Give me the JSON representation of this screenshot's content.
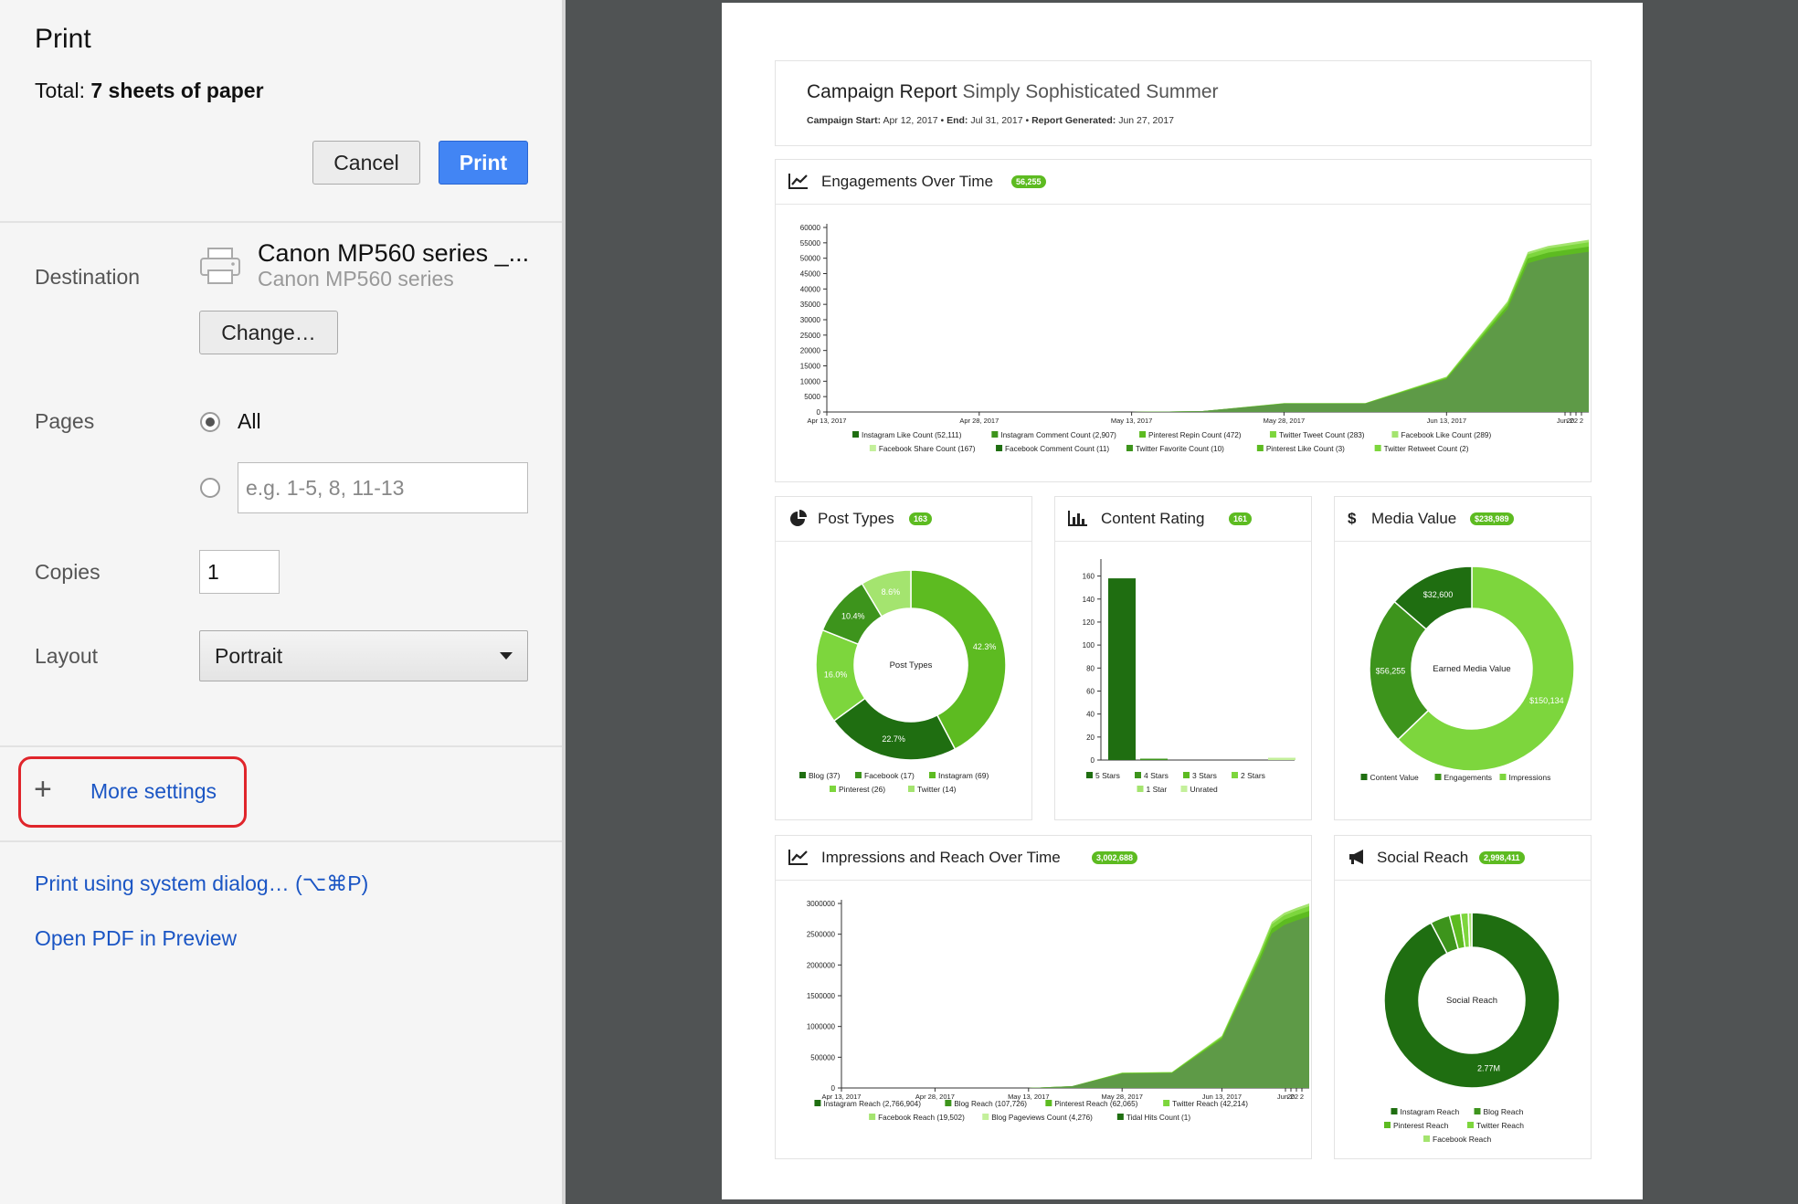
{
  "dialog": {
    "title": "Print",
    "total_label": "Total: ",
    "total_value": "7 sheets of paper",
    "cancel_label": "Cancel",
    "print_label": "Print",
    "destination_label": "Destination",
    "destination_name": "Canon MP560 series _...",
    "destination_sub": "Canon MP560 series",
    "change_label": "Change…",
    "pages_label": "Pages",
    "pages_all_label": "All",
    "pages_placeholder": "e.g. 1-5, 8, 11-13",
    "copies_label": "Copies",
    "copies_value": "1",
    "layout_label": "Layout",
    "layout_value": "Portrait",
    "more_settings_label": "More settings",
    "system_dialog_label": "Print using system dialog… (⌥⌘P)",
    "open_pdf_label": "Open PDF in Preview",
    "highlight_color": "#e0252b",
    "link_color": "#1a55c4",
    "primary_color": "#4285f4"
  },
  "report": {
    "title": "Campaign Report",
    "subtitle": "Simply Sophisticated Summer",
    "start_label": "Campaign Start:",
    "start_value": "Apr 12, 2017",
    "end_label": "End:",
    "end_value": "Jul 31, 2017",
    "generated_label": "Report Generated:",
    "generated_value": "Jun 27, 2017",
    "accent": "#5dbb21",
    "palette": [
      "#1f6e11",
      "#3d941c",
      "#5dbb21",
      "#7dd63d",
      "#a4e46f",
      "#c4f09b"
    ]
  },
  "chart_data": [
    {
      "id": "engagements",
      "type": "area",
      "title": "Engagements Over Time",
      "badge": "56,255",
      "xticks": [
        "Apr 13, 2017",
        "Apr 28, 2017",
        "May 13, 2017",
        "May 28, 2017",
        "Jun 13, 2017",
        "Jun 2",
        "20",
        "2",
        "2"
      ],
      "ylim": [
        0,
        60000
      ],
      "yticks": [
        0,
        5000,
        10000,
        15000,
        20000,
        25000,
        30000,
        35000,
        40000,
        45000,
        50000,
        55000,
        60000
      ],
      "x": [
        "Apr 13, 2017",
        "May 13, 2017",
        "May 20, 2017",
        "May 28, 2017",
        "Jun 5, 2017",
        "Jun 13, 2017",
        "Jun 19, 2017",
        "Jun 21, 2017",
        "Jun 23, 2017",
        "Jun 25, 2017",
        "Jun 27, 2017"
      ],
      "total": [
        0,
        0,
        300,
        2900,
        2900,
        11500,
        36000,
        52000,
        54000,
        55000,
        56000
      ],
      "series": [
        {
          "name": "Instagram Like Count (52,111)"
        },
        {
          "name": "Instagram Comment Count (2,907)"
        },
        {
          "name": "Pinterest Repin Count (472)"
        },
        {
          "name": "Twitter Tweet Count (283)"
        },
        {
          "name": "Facebook Like Count (289)"
        },
        {
          "name": "Facebook Share Count (167)"
        },
        {
          "name": "Facebook Comment Count (11)"
        },
        {
          "name": "Twitter Favorite Count (10)"
        },
        {
          "name": "Pinterest Like Count (3)"
        },
        {
          "name": "Twitter Retweet Count (2)"
        }
      ],
      "legend_rows": [
        5,
        5
      ]
    },
    {
      "id": "post_types",
      "type": "pie",
      "title": "Post Types",
      "badge": "163",
      "center_label": "Post Types",
      "slices": [
        {
          "name": "Instagram (69)",
          "value": 42.3,
          "label": "42.3%"
        },
        {
          "name": "Blog (37)",
          "value": 22.7,
          "label": "22.7%"
        },
        {
          "name": "Pinterest (26)",
          "value": 16.0,
          "label": "16.0%"
        },
        {
          "name": "Facebook (17)",
          "value": 10.4,
          "label": "10.4%"
        },
        {
          "name": "Twitter (14)",
          "value": 8.6,
          "label": "8.6%"
        }
      ],
      "legend": [
        "Blog (37)",
        "Facebook (17)",
        "Instagram (69)",
        "Pinterest (26)",
        "Twitter (14)"
      ]
    },
    {
      "id": "content_rating",
      "type": "bar",
      "title": "Content Rating",
      "badge": "161",
      "categories": [
        "5 Stars",
        "4 Stars",
        "3 Stars",
        "2 Stars",
        "1 Star",
        "Unrated"
      ],
      "values": [
        158,
        1,
        0,
        0,
        0,
        2
      ],
      "ylim": [
        0,
        170
      ],
      "yticks": [
        0,
        20,
        40,
        60,
        80,
        100,
        120,
        140,
        160
      ],
      "legend": [
        "5 Stars",
        "4 Stars",
        "3 Stars",
        "2 Stars",
        "1 Star",
        "Unrated"
      ]
    },
    {
      "id": "media_value",
      "type": "pie",
      "title": "Media Value",
      "badge": "$238,989",
      "center_label": "Earned Media Value",
      "slices": [
        {
          "name": "Impressions",
          "value": 150134,
          "label": "$150,134"
        },
        {
          "name": "Engagements",
          "value": 56255,
          "label": "$56,255"
        },
        {
          "name": "Content Value",
          "value": 32600,
          "label": "$32,600"
        }
      ],
      "legend": [
        "Content Value",
        "Engagements",
        "Impressions"
      ]
    },
    {
      "id": "impressions",
      "type": "area",
      "title": "Impressions and Reach Over Time",
      "badge": "3,002,688",
      "xticks": [
        "Apr 13, 2017",
        "Apr 28, 2017",
        "May 13, 2017",
        "May 28, 2017",
        "Jun 13, 2017",
        "Jun 2",
        "20",
        "2",
        "2"
      ],
      "ylim": [
        0,
        3000000
      ],
      "yticks": [
        0,
        500000,
        1000000,
        1500000,
        2000000,
        2500000,
        3000000
      ],
      "x": [
        "Apr 13, 2017",
        "May 13, 2017",
        "May 20, 2017",
        "May 28, 2017",
        "Jun 5, 2017",
        "Jun 13, 2017",
        "Jun 19, 2017",
        "Jun 21, 2017",
        "Jun 23, 2017",
        "Jun 25, 2017",
        "Jun 27, 2017"
      ],
      "total": [
        0,
        0,
        30000,
        250000,
        260000,
        850000,
        2200000,
        2700000,
        2850000,
        2930000,
        3000000
      ],
      "series": [
        {
          "name": "Instagram Reach (2,766,904)"
        },
        {
          "name": "Blog Reach (107,726)"
        },
        {
          "name": "Pinterest Reach (62,065)"
        },
        {
          "name": "Twitter Reach (42,214)"
        },
        {
          "name": "Facebook Reach (19,502)"
        },
        {
          "name": "Blog Pageviews Count (4,276)"
        },
        {
          "name": "Tidal Hits Count (1)"
        }
      ],
      "legend_rows": [
        4,
        3
      ]
    },
    {
      "id": "social_reach",
      "type": "pie",
      "title": "Social Reach",
      "badge": "2,998,411",
      "center_label": "Social Reach",
      "slices": [
        {
          "name": "Instagram Reach",
          "value": 2766904,
          "label": "2.77M"
        },
        {
          "name": "Blog Reach",
          "value": 107726,
          "label": ""
        },
        {
          "name": "Pinterest Reach",
          "value": 62065,
          "label": ""
        },
        {
          "name": "Twitter Reach",
          "value": 42214,
          "label": ""
        },
        {
          "name": "Facebook Reach",
          "value": 19502,
          "label": ""
        }
      ],
      "legend": [
        "Instagram Reach",
        "Blog Reach",
        "Pinterest Reach",
        "Twitter Reach",
        "Facebook Reach"
      ]
    }
  ]
}
